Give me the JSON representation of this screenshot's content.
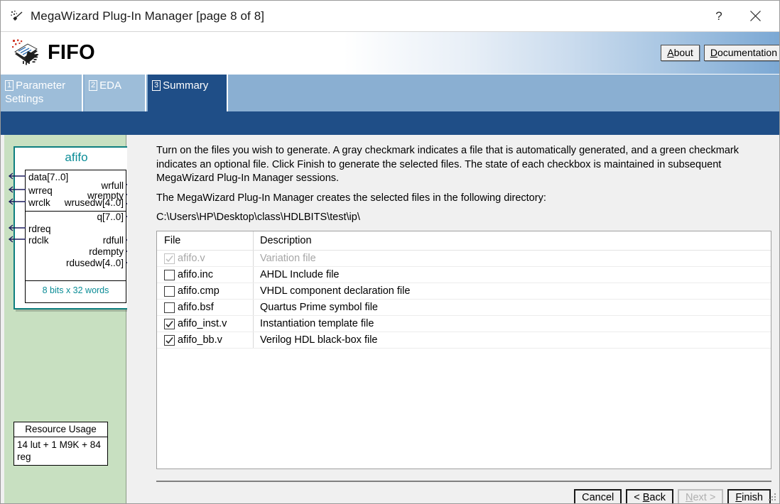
{
  "window": {
    "title": "MegaWizard Plug-In Manager [page 8 of 8]",
    "icon": "magic-wand-icon",
    "help_label": "?",
    "close_label": "×"
  },
  "banner": {
    "title": "FIFO",
    "icon": "ip-chip-icon",
    "buttons": [
      {
        "name": "about",
        "label": "About",
        "mnemonic": "A"
      },
      {
        "name": "documentation",
        "label": "Documentation",
        "mnemonic": "D"
      }
    ]
  },
  "tabs": [
    {
      "num": "1",
      "label": "Parameter Settings",
      "active": false
    },
    {
      "num": "2",
      "label": "EDA",
      "active": false
    },
    {
      "num": "3",
      "label": "Summary",
      "active": true
    }
  ],
  "block_diagram": {
    "name": "afifo",
    "inputs_group1": [
      "data[7..0]",
      "wrreq",
      "wrclk"
    ],
    "outputs_group1": [
      "wrfull",
      "wrempty",
      "wrusedw[4..0]"
    ],
    "inputs_group2": [
      "rdreq",
      "rdclk"
    ],
    "outputs_group2": [
      "q[7..0]",
      "rdfull",
      "rdempty",
      "rdusedw[4..0]"
    ],
    "footer": "8 bits x 32 words"
  },
  "resource_usage": {
    "title": "Resource Usage",
    "value": "14 lut + 1 M9K + 84 reg"
  },
  "main": {
    "intro": "Turn on the files you wish to generate. A gray checkmark indicates a file that is automatically generated, and a green checkmark indicates an optional file. Click Finish to generate the selected files. The state of each checkbox is maintained in subsequent MegaWizard Plug-In Manager sessions.",
    "directory_label": "The MegaWizard Plug-In Manager creates the selected files in the following directory:",
    "directory_path": "C:\\Users\\HP\\Desktop\\class\\HDLBITS\\test\\ip\\"
  },
  "file_table": {
    "columns": [
      "File",
      "Description"
    ],
    "rows": [
      {
        "file": "afifo.v",
        "description": "Variation file",
        "state": "auto"
      },
      {
        "file": "afifo.inc",
        "description": "AHDL Include file",
        "state": "unchecked"
      },
      {
        "file": "afifo.cmp",
        "description": "VHDL component declaration file",
        "state": "unchecked"
      },
      {
        "file": "afifo.bsf",
        "description": "Quartus Prime symbol file",
        "state": "unchecked"
      },
      {
        "file": "afifo_inst.v",
        "description": "Instantiation template file",
        "state": "checked"
      },
      {
        "file": "afifo_bb.v",
        "description": "Verilog HDL black-box file",
        "state": "checked"
      }
    ]
  },
  "footer_buttons": [
    {
      "name": "cancel",
      "label": "Cancel",
      "pre": "",
      "mnemonic": "",
      "post": "Cancel",
      "disabled": false
    },
    {
      "name": "back",
      "label": "< Back",
      "pre": "< ",
      "mnemonic": "B",
      "post": "ack",
      "disabled": false
    },
    {
      "name": "next",
      "label": "Next >",
      "pre": "",
      "mnemonic": "N",
      "post": "ext >",
      "disabled": true
    },
    {
      "name": "finish",
      "label": "Finish",
      "pre": "",
      "mnemonic": "F",
      "post": "inish",
      "disabled": false
    }
  ],
  "colors": {
    "tab_active": "#1f4e87",
    "tab_inactive": "#9dbdd9",
    "tabstrip": "#8aafd2",
    "left_panel": "#c8e0c1",
    "diagram_accent": "#0a8c96",
    "content_bg": "#f0f0f0"
  }
}
